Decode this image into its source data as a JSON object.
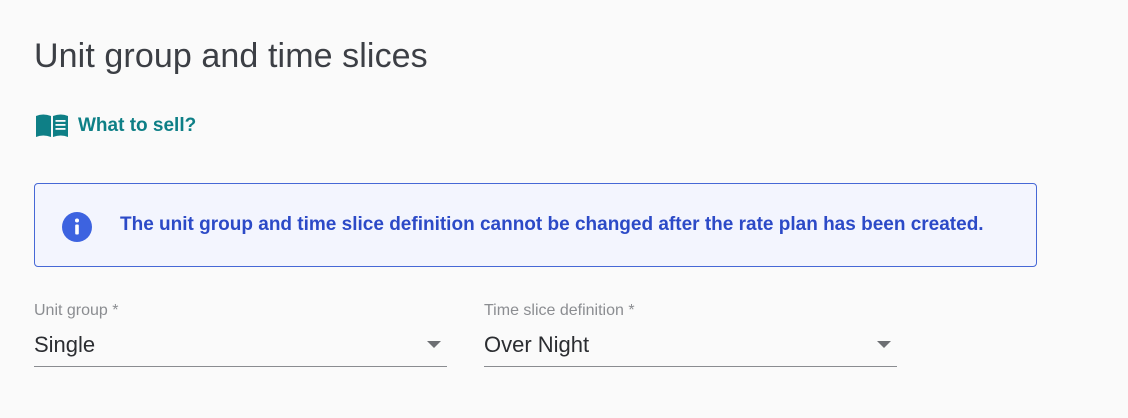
{
  "page": {
    "title": "Unit group and time slices"
  },
  "help_link": {
    "label": "What to sell?",
    "icon": "book-icon"
  },
  "alert": {
    "icon": "info-icon",
    "message": "The unit group and time slice definition cannot be changed after the rate plan has been created.",
    "accent_color": "#2c4ac7"
  },
  "fields": {
    "unit_group": {
      "label": "Unit group *",
      "value": "Single"
    },
    "time_slice_definition": {
      "label": "Time slice definition *",
      "value": "Over Night"
    }
  },
  "colors": {
    "link": "#0e7f86",
    "alert_border": "#4668d6",
    "alert_background": "#f3f5fe",
    "background": "#fafafa"
  }
}
